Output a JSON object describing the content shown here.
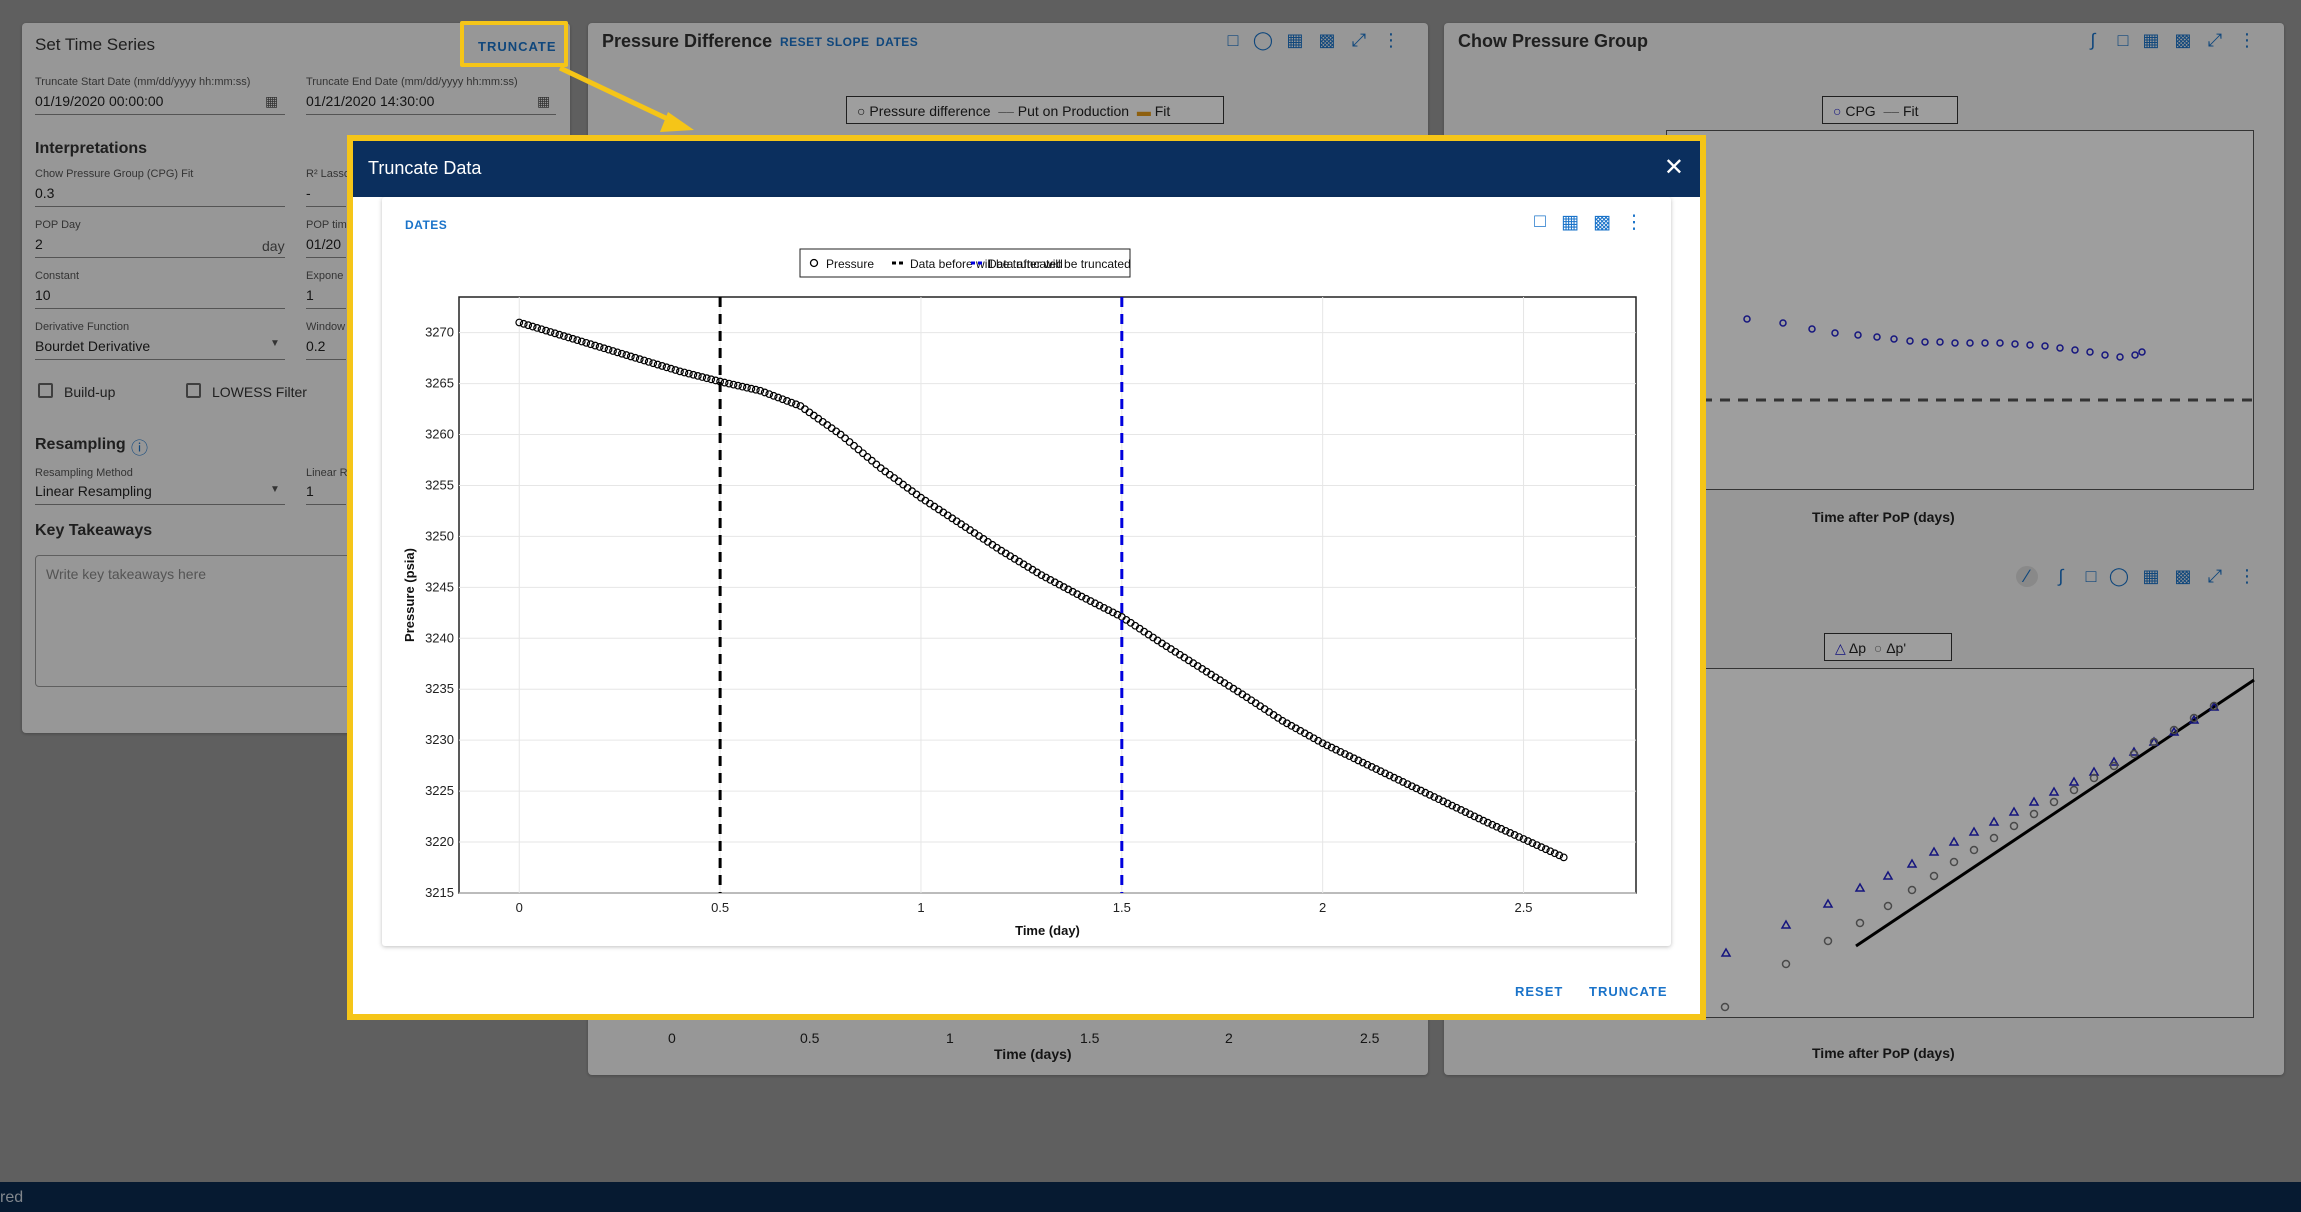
{
  "left_panel": {
    "title": "Set Time Series",
    "truncate_button": "TRUNCATE",
    "start_label": "Truncate Start Date (mm/dd/yyyy hh:mm:ss)",
    "start_value": "01/19/2020 00:00:00",
    "end_label": "Truncate End Date (mm/dd/yyyy hh:mm:ss)",
    "end_value": "01/21/2020 14:30:00",
    "interpretations_heading": "Interpretations",
    "cpg_fit_label": "Chow Pressure Group (CPG) Fit",
    "cpg_fit_value": "0.3",
    "r2_label": "R² Lasso",
    "r2_value": "-",
    "pop_day_label": "POP Day",
    "pop_day_value": "2",
    "pop_day_unit": "day",
    "pop_time_label": "POP tim",
    "pop_time_value": "01/20",
    "constant_label": "Constant",
    "constant_value": "10",
    "exponent_label": "Expone",
    "exponent_value": "1",
    "derivative_label": "Derivative Function",
    "derivative_value": "Bourdet Derivative",
    "window_label": "Window",
    "window_value": "0.2",
    "buildup_label": "Build-up",
    "lowess_label": "LOWESS Filter",
    "resampling_heading": "Resampling",
    "resampling_method_label": "Resampling Method",
    "resampling_method_value": "Linear Resampling",
    "linear_label": "Linear R",
    "linear_value": "1",
    "takeaways_heading": "Key Takeaways",
    "takeaways_placeholder": "Write key takeaways here"
  },
  "pressure_panel": {
    "title": "Pressure Difference",
    "reset_slope": "RESET SLOPE",
    "dates": "DATES",
    "legend": [
      "Pressure difference",
      "Put on Production",
      "Fit"
    ],
    "x_ticks": [
      "0",
      "0.5",
      "1",
      "1.5",
      "2",
      "2.5"
    ],
    "x_label": "Time (days)"
  },
  "chow_panel": {
    "title": "Chow Pressure Group",
    "legend": [
      "CPG",
      "Fit"
    ],
    "x_label": "Time after PoP (days)",
    "lower_legend": [
      "Δp",
      "Δp'"
    ],
    "lower_x_label": "Time after PoP (days)"
  },
  "footer": {
    "text": "red"
  },
  "modal": {
    "title": "Truncate Data",
    "dates_link": "DATES",
    "reset_button": "RESET",
    "truncate_button": "TRUNCATE",
    "icons": [
      "lock-open-icon",
      "table-icon",
      "scatter-icon",
      "more-vert-icon"
    ]
  },
  "chart_data": {
    "type": "scatter",
    "xlabel": "Time (day)",
    "ylabel": "Pressure (psia)",
    "xlim": [
      -0.15,
      2.78
    ],
    "ylim": [
      3215,
      3273.5
    ],
    "x_ticks": [
      0,
      0.5,
      1,
      1.5,
      2,
      2.5
    ],
    "y_ticks": [
      3215,
      3220,
      3225,
      3230,
      3235,
      3240,
      3245,
      3250,
      3255,
      3260,
      3265,
      3270
    ],
    "grid": true,
    "legend_position": "top-center",
    "series": [
      {
        "name": "Pressure",
        "marker": "open-circle",
        "color": "#000000",
        "x": [
          0,
          0.1,
          0.2,
          0.3,
          0.4,
          0.5,
          0.6,
          0.7,
          0.8,
          0.9,
          1.0,
          1.1,
          1.2,
          1.3,
          1.4,
          1.5,
          1.6,
          1.7,
          1.8,
          1.9,
          2.0,
          2.1,
          2.2,
          2.3,
          2.4,
          2.5,
          2.6
        ],
        "y": [
          3271,
          3269.8,
          3268.6,
          3267.4,
          3266.2,
          3265.2,
          3264.3,
          3262.8,
          3260,
          3256.7,
          3253.8,
          3251.2,
          3248.6,
          3246.2,
          3244.1,
          3242.1,
          3239.5,
          3237,
          3234.5,
          3231.9,
          3229.7,
          3227.8,
          3225.9,
          3224,
          3222.1,
          3220.3,
          3218.5
        ]
      },
      {
        "name": "Data before will be truncated",
        "type": "vline",
        "x": 0.5,
        "color": "#000000",
        "style": "dashed"
      },
      {
        "name": "Data after will be truncated",
        "type": "vline",
        "x": 1.5,
        "color": "#0000dd",
        "style": "dashed"
      }
    ]
  }
}
